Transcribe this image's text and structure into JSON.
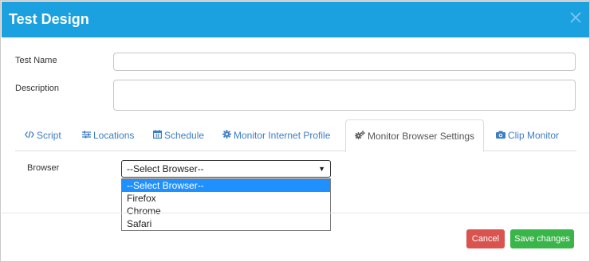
{
  "modal": {
    "title": "Test Design",
    "close_icon": "close-icon"
  },
  "form": {
    "test_name_label": "Test Name",
    "test_name_value": "",
    "description_label": "Description",
    "description_value": "",
    "browser_label": "Browser"
  },
  "tabs": [
    {
      "label": "Script",
      "icon": "code-icon"
    },
    {
      "label": "Locations",
      "icon": "sliders-icon"
    },
    {
      "label": "Schedule",
      "icon": "calendar-icon"
    },
    {
      "label": "Monitor Internet Profile",
      "icon": "gear-icon"
    },
    {
      "label": "Monitor Browser Settings",
      "icon": "gears-icon"
    },
    {
      "label": "Clip Monitor",
      "icon": "camera-icon"
    }
  ],
  "active_tab": "Monitor Browser Settings",
  "browser_select": {
    "selected": "--Select Browser--",
    "options": [
      "--Select Browser--",
      "Firefox",
      "Chrome",
      "Safari"
    ]
  },
  "footer": {
    "cancel_label": "Cancel",
    "save_label": "Save changes"
  },
  "colors": {
    "header": "#1ca1e0",
    "tab_link": "#3d7ec4",
    "cancel": "#d9534f",
    "save": "#3ab54a",
    "option_highlight": "#1e90ff"
  }
}
